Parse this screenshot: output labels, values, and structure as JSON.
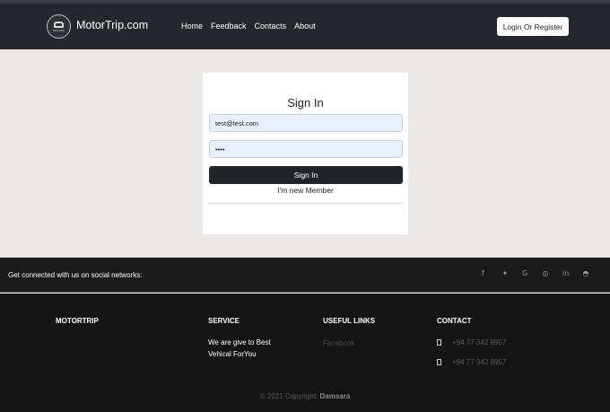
{
  "header": {
    "logo_text": "MotorTrip",
    "brand": "MotorTrip.com",
    "nav": [
      "Home",
      "Feedback",
      "Contacts",
      "About"
    ],
    "login_label": "Login Or Register"
  },
  "signin": {
    "title": "Sign In",
    "email_value": "test@test.com",
    "password_value": "••••",
    "button_label": "Sign In",
    "new_member_link": "I'm new Member"
  },
  "social": {
    "text": "Get connected with us on social networks:",
    "icons": [
      "f",
      "✦",
      "G",
      "◎",
      "in",
      "◓"
    ]
  },
  "footer": {
    "motortrip_heading": "MOTORTRIP",
    "service_heading": "SERVICE",
    "service_text_1": "We are give to Best",
    "service_text_2": "Vehical ForYou",
    "links_heading": "USEFUL LINKS",
    "link_facebook": "Facebook",
    "contact_heading": "CONTACT",
    "phone_1": "+94 77 342 8957",
    "phone_2": "+94 77 342 8957",
    "copyright_prefix": "© 2021 Copyright:",
    "copyright_name": "Damsara"
  }
}
